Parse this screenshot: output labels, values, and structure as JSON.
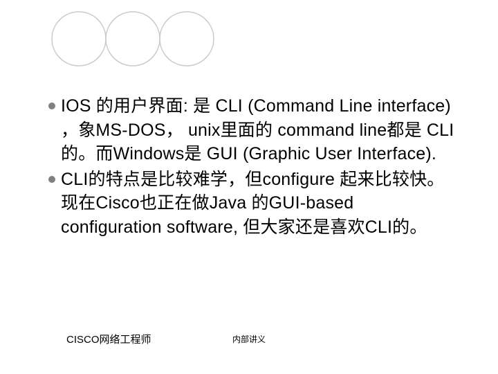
{
  "bullets": [
    "IOS 的用户界面: 是 CLI (Command Line interface) ，象MS-DOS， unix里面的 command line都是 CLI的。而Windows是 GUI (Graphic User Interface).",
    "CLI的特点是比较难学，但configure 起来比较快。现在Cisco也正在做Java 的GUI-based configuration software, 但大家还是喜欢CLI的。"
  ],
  "footer": {
    "left": "CISCO网络工程师",
    "center": "内部讲义"
  },
  "decor": {
    "circle_count": 3
  }
}
